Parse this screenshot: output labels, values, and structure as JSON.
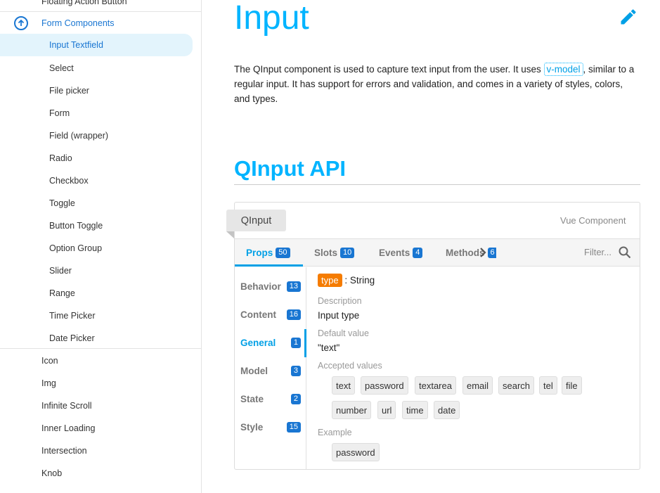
{
  "sidebar": {
    "top_partial": "Floating Action Button",
    "group_label": "Form Components",
    "sub_items": [
      "Input Textfield",
      "Select",
      "File picker",
      "Form",
      "Field (wrapper)",
      "Radio",
      "Checkbox",
      "Toggle",
      "Button Toggle",
      "Option Group",
      "Slider",
      "Range",
      "Time Picker",
      "Date Picker"
    ],
    "items": [
      "Icon",
      "Img",
      "Infinite Scroll",
      "Inner Loading",
      "Intersection",
      "Knob"
    ]
  },
  "page": {
    "title": "Input",
    "desc_before": "The QInput component is used to capture text input from the user. It uses ",
    "desc_code": "v-model",
    "desc_after": ", similar to a regular input. It has support for errors and validation, and comes in a variety of styles, colors, and types."
  },
  "api": {
    "title": "QInput API",
    "component_tag": "QInput",
    "component_type": "Vue Component",
    "tabs": [
      {
        "label": "Props",
        "count": "50"
      },
      {
        "label": "Slots",
        "count": "10"
      },
      {
        "label": "Events",
        "count": "4"
      },
      {
        "label": "Methods",
        "count": "6"
      }
    ],
    "filter_placeholder": "Filter...",
    "categories": [
      {
        "label": "Behavior",
        "count": "13"
      },
      {
        "label": "Content",
        "count": "16"
      },
      {
        "label": "General",
        "count": "1"
      },
      {
        "label": "Model",
        "count": "3"
      },
      {
        "label": "State",
        "count": "2"
      },
      {
        "label": "Style",
        "count": "15"
      }
    ],
    "prop": {
      "name": "type",
      "type_text": ": String",
      "desc_label": "Description",
      "desc": "Input type",
      "default_label": "Default value",
      "default": "\"text\"",
      "accepted_label": "Accepted values",
      "accepted": [
        "text",
        "password",
        "textarea",
        "email",
        "search",
        "tel",
        "file",
        "number",
        "url",
        "time",
        "date"
      ],
      "example_label": "Example",
      "example": "password"
    }
  },
  "colors": {
    "accent": "#00b4ff",
    "link": "#1976d2",
    "type_chip": "#f57c00"
  }
}
